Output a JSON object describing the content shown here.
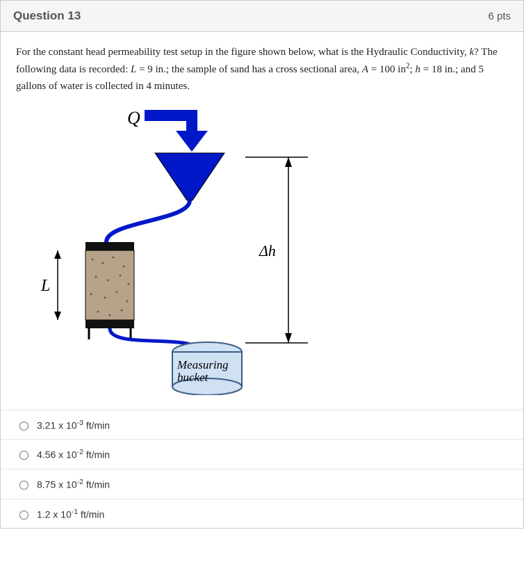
{
  "header": {
    "title": "Question 13",
    "points": "6 pts"
  },
  "prompt": {
    "p1a": "For the constant head permeability test setup in the figure shown below, what is the Hydraulic Conductivity, ",
    "p1b": "k",
    "p1c": "?  The following data is recorded: ",
    "p1d": "L",
    "p1e": " = 9 in.; the sample of sand has a cross sectional area, ",
    "p1f": "A",
    "p1g": " = 100 in",
    "p1h": "2",
    "p1i": "; ",
    "p1j": "h",
    "p1k": " = 18 in.; and 5 gallons of water is collected in 4 minutes."
  },
  "figure": {
    "Q": "Q",
    "L": "L",
    "dh": "Δh",
    "bucket_l1": "Measuring",
    "bucket_l2": "bucket"
  },
  "answers": [
    {
      "pre": "3.21 x 10",
      "exp": "-3",
      "post": " ft/min"
    },
    {
      "pre": "4.56 x 10",
      "exp": "-2",
      "post": " ft/min"
    },
    {
      "pre": "8.75 x 10",
      "exp": "-2",
      "post": " ft/min"
    },
    {
      "pre": "1.2 x 10",
      "exp": "-1",
      "post": " ft/min"
    }
  ]
}
